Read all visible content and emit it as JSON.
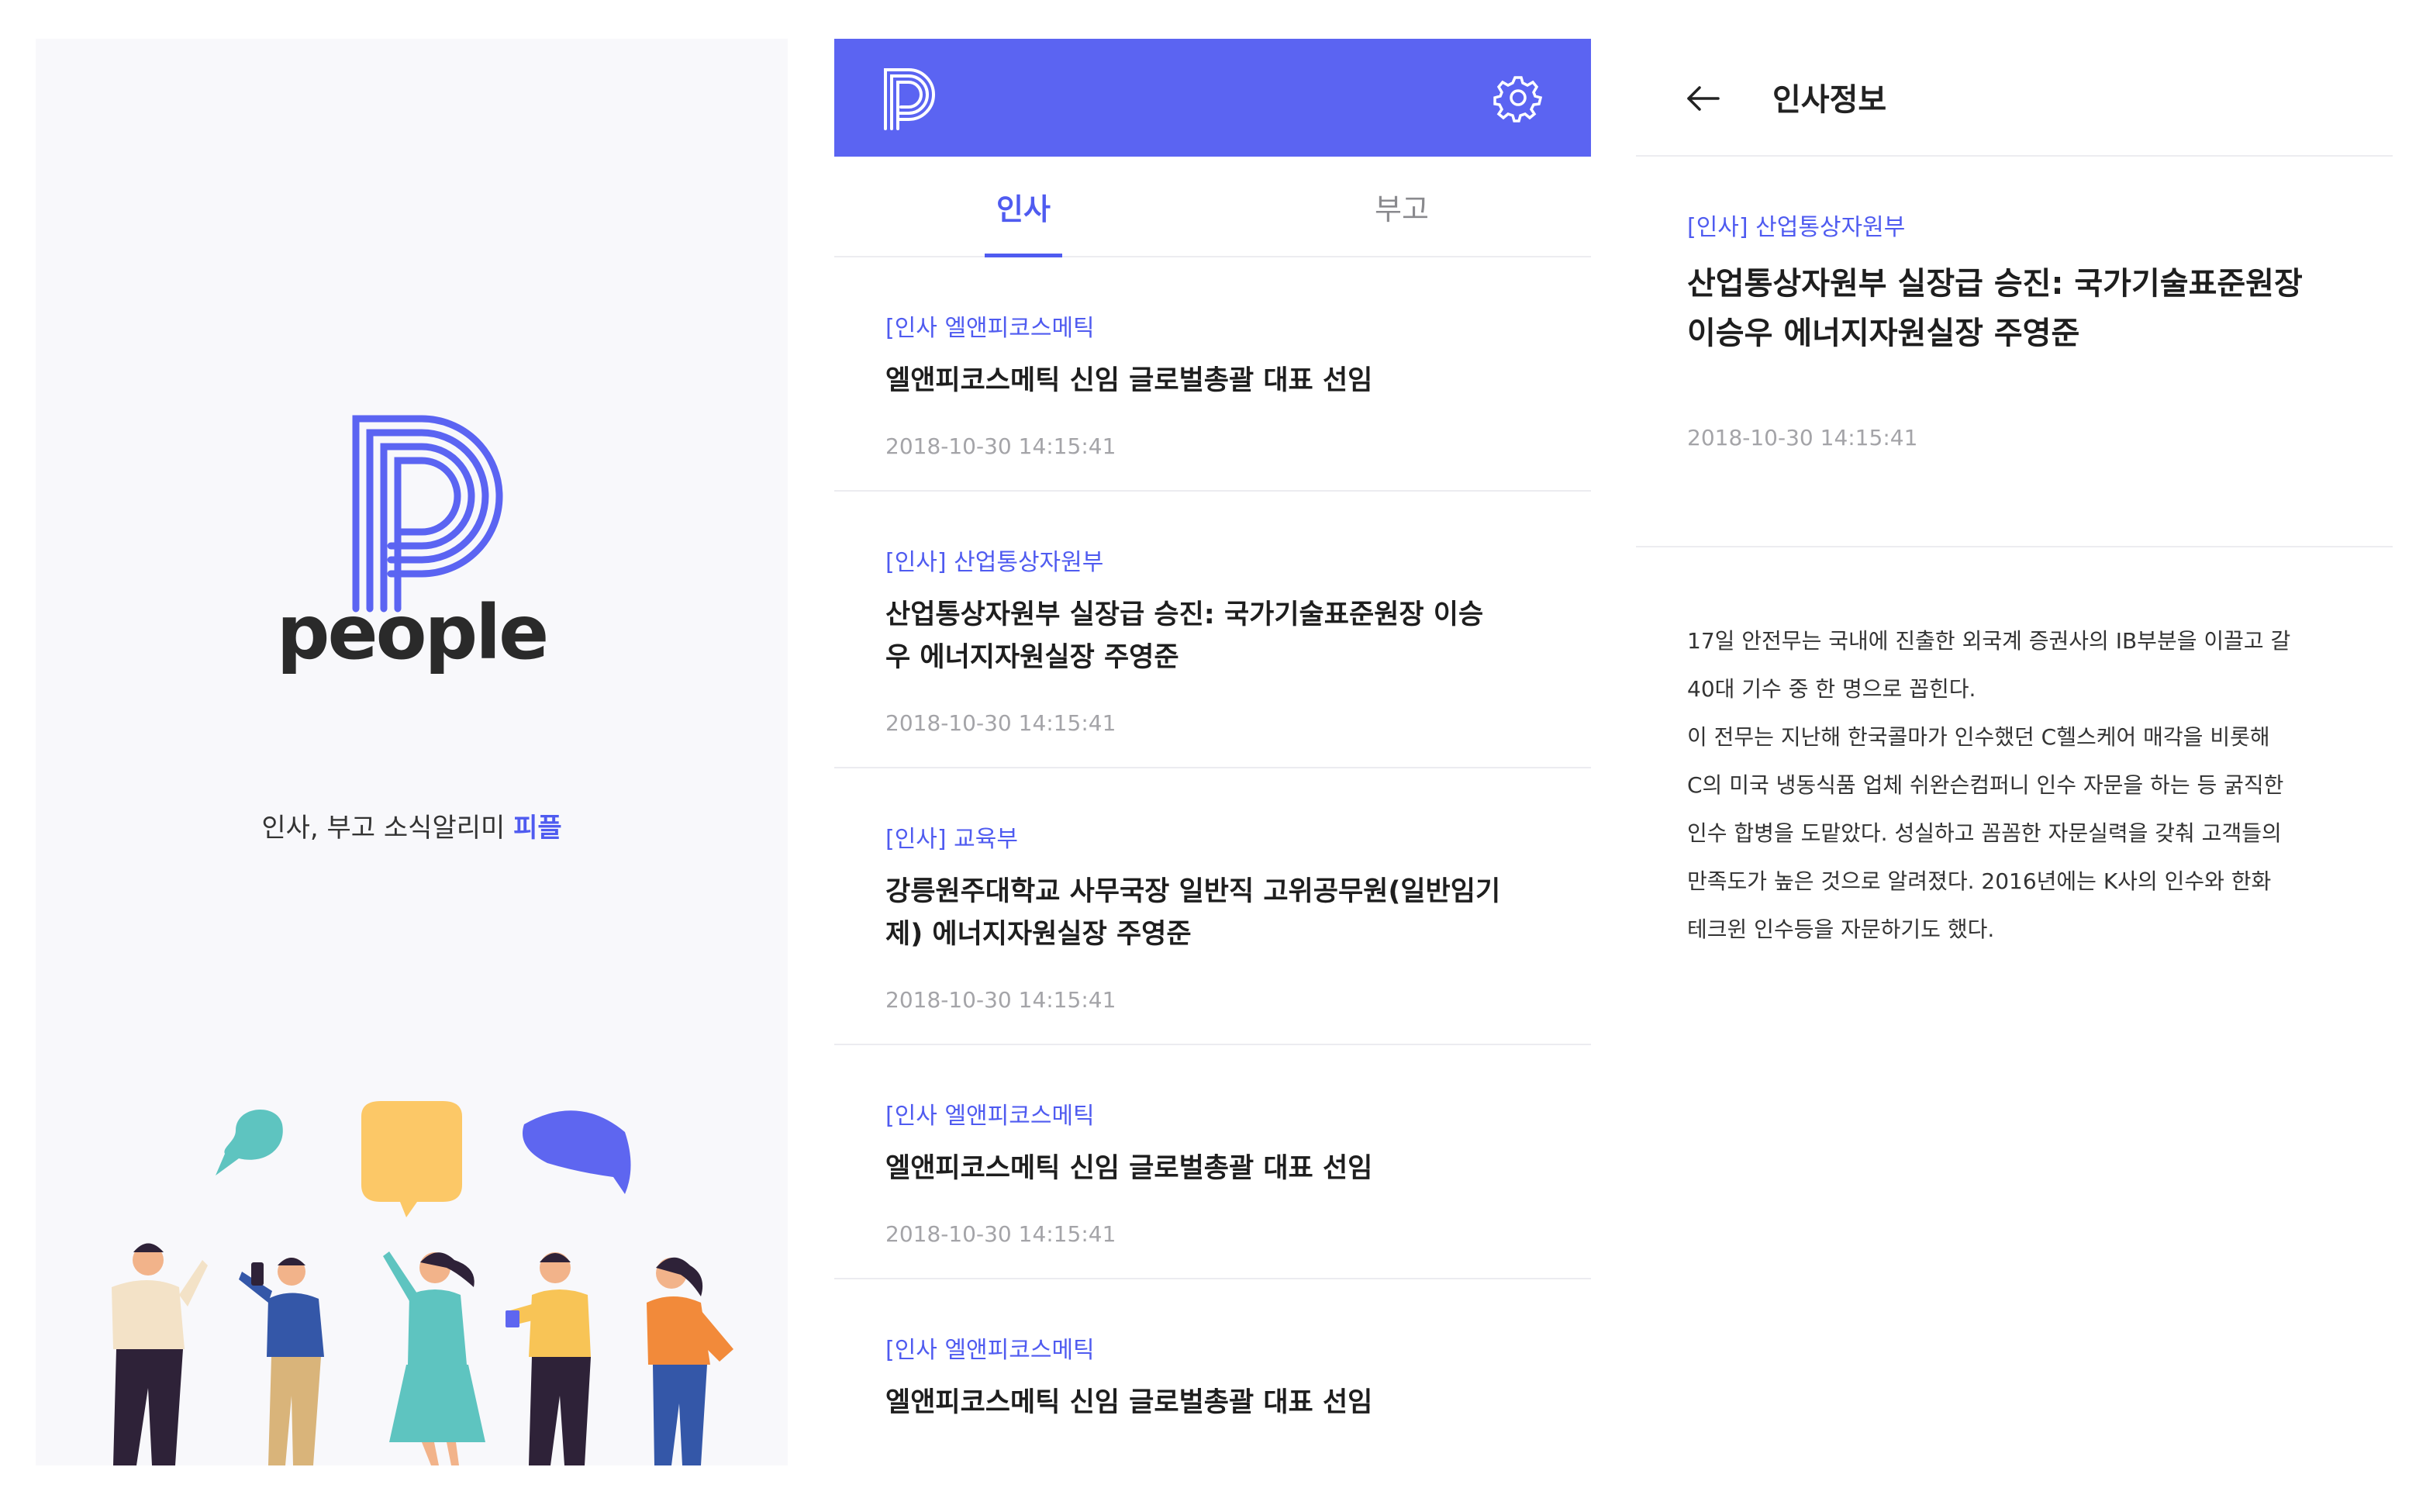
{
  "splash": {
    "wordmark": "people",
    "tagline_prefix": "인사, 부고 소식알리미 ",
    "tagline_brand": "피플",
    "logo_icon": "people-p-logo",
    "illustration": "people-chatting-illustration"
  },
  "list": {
    "appbar": {
      "logo_icon": "people-p-logo",
      "settings_icon": "gear-icon",
      "color": "#5b64f2"
    },
    "tabs": [
      {
        "label": "인사",
        "active": true
      },
      {
        "label": "부고",
        "active": false
      }
    ],
    "items": [
      {
        "category": "[인사 엘앤피코스메틱",
        "title": "엘앤피코스메틱 신임 글로벌총괄 대표 선임",
        "date": "2018-10-30 14:15:41"
      },
      {
        "category": "[인사] 산업통상자원부",
        "title": "산업통상자원부 실장급 승진: 국가기술표준원장 이승우 에너지자원실장 주영준",
        "date": "2018-10-30 14:15:41"
      },
      {
        "category": "[인사] 교육부",
        "title": "강릉원주대학교 사무국장 일반직 고위공무원(일반임기제) 에너지자원실장 주영준",
        "date": "2018-10-30 14:15:41"
      },
      {
        "category": "[인사 엘앤피코스메틱",
        "title": "엘앤피코스메틱 신임 글로벌총괄 대표 선임",
        "date": "2018-10-30 14:15:41"
      },
      {
        "category": "[인사 엘앤피코스메틱",
        "title": "엘앤피코스메틱 신임 글로벌총괄 대표 선임",
        "date": ""
      }
    ]
  },
  "detail": {
    "header_title": "인사정보",
    "back_icon": "arrow-left-icon",
    "category": "[인사] 산업통상자원부",
    "title_line1": "산업통상자원부 실장급 승진: 국가기술표준원장",
    "title_line2": "이승우 에너지자원실장 주영준",
    "date": "2018-10-30 14:15:41",
    "body": [
      "17일 안전무는 국내에 진출한 외국계 증권사의 IB부분을 이끌고 갈",
      "40대 기수 중 한 명으로 꼽힌다.",
      "이 전무는 지난해 한국콜마가 인수했던 C헬스케어 매각을 비롯해",
      "C의 미국 냉동식품 업체 쉬완슨컴퍼니 인수 자문을 하는 등 굵직한",
      "인수 합병을 도맡았다. 성실하고 꼼꼼한 자문실력을 갖춰 고객들의",
      "만족도가 높은 것으로 알려졌다. 2016년에는 K사의 인수와 한화",
      "테크윈 인수등을 자문하기도 했다."
    ]
  },
  "colors": {
    "accent": "#4f5bf0",
    "appbar": "#5b64f2",
    "date": "#a4a4a8"
  }
}
